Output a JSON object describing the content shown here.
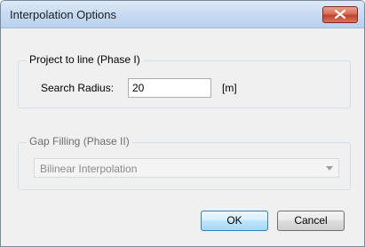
{
  "window": {
    "title": "Interpolation Options"
  },
  "phase1": {
    "group_label": "Project to line (Phase I)",
    "search_radius_label": "Search Radius:",
    "search_radius_value": "20",
    "unit_label": "[m]"
  },
  "phase2": {
    "group_label": "Gap Filling (Phase II)",
    "method_selected": "Bilinear Interpolation",
    "enabled": false
  },
  "buttons": {
    "ok_label": "OK",
    "cancel_label": "Cancel"
  },
  "icons": {
    "close": "close-icon",
    "dropdown": "chevron-down-icon"
  },
  "colors": {
    "titlebar": "#c7dbf1",
    "close_button": "#c0442b",
    "dialog_background": "#f0f0f0",
    "default_button_border": "#3c7fb1"
  }
}
